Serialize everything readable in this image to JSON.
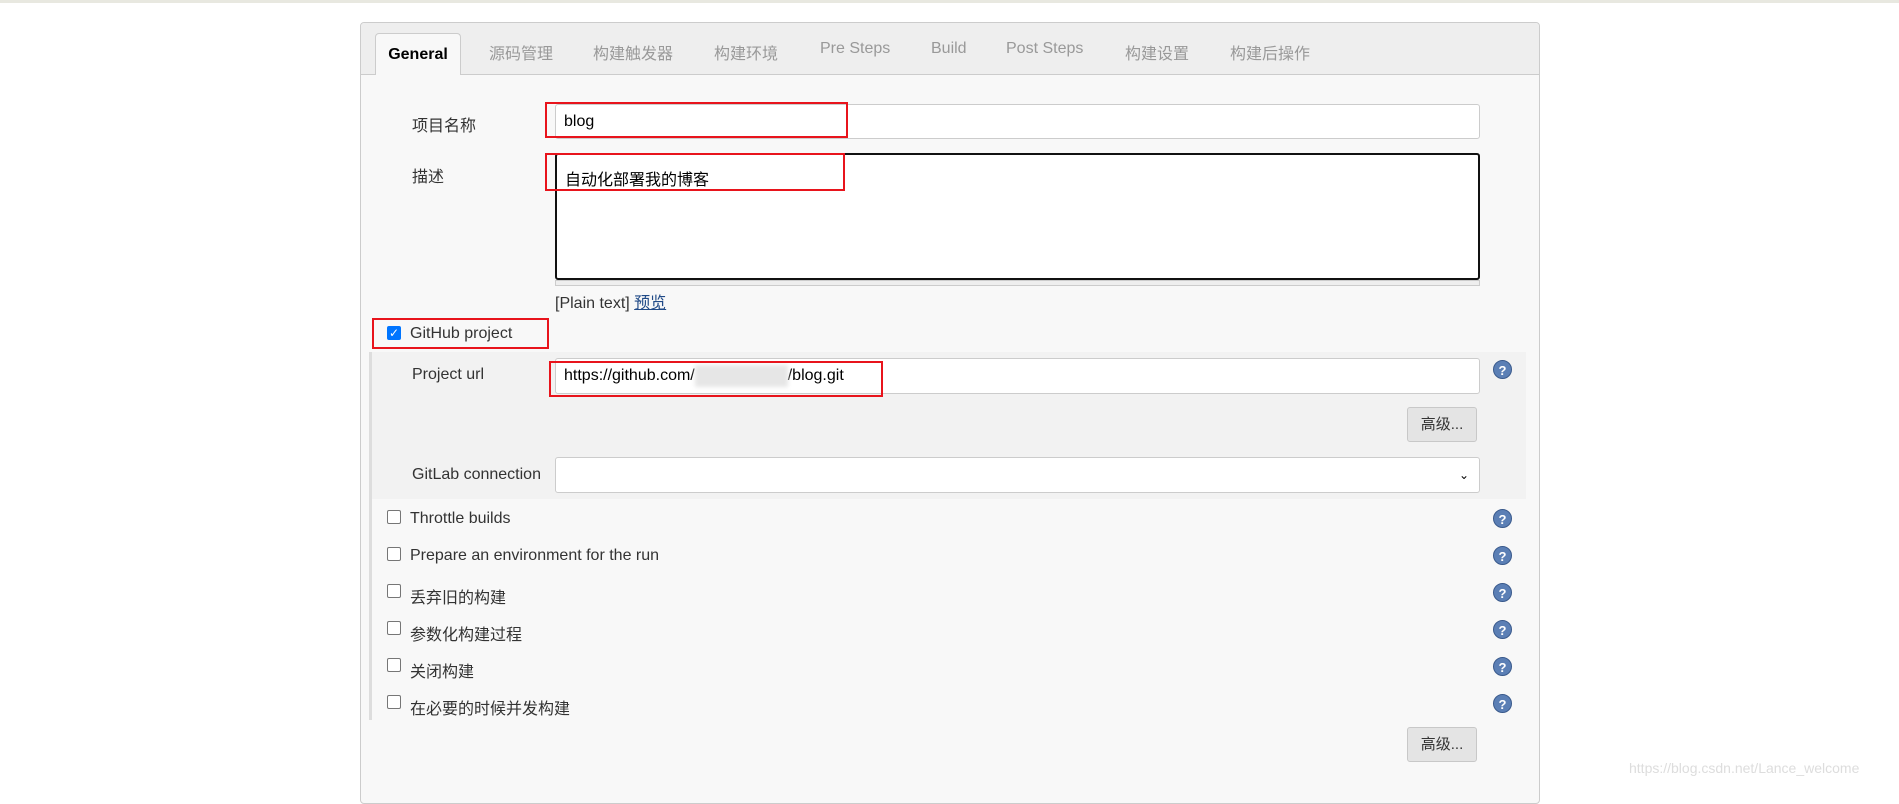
{
  "tabs": [
    {
      "label": "General",
      "active": true
    },
    {
      "label": "源码管理"
    },
    {
      "label": "构建触发器"
    },
    {
      "label": "构建环境"
    },
    {
      "label": "Pre Steps"
    },
    {
      "label": "Build"
    },
    {
      "label": "Post Steps"
    },
    {
      "label": "构建设置"
    },
    {
      "label": "构建后操作"
    }
  ],
  "form": {
    "name_label": "项目名称",
    "name_value": "blog",
    "desc_label": "描述",
    "desc_value": "自动化部署我的博客",
    "plain_text": "[Plain text]",
    "preview_link": "预览",
    "github_project_label": "GitHub project",
    "github_project_checked": true,
    "project_url_label": "Project url",
    "project_url_prefix": "https://github.com/",
    "project_url_suffix": "/blog.git",
    "advanced_label": "高级...",
    "gitlab_label": "GitLab connection",
    "gitlab_value": "",
    "options": [
      {
        "label": "Throttle builds",
        "checked": false
      },
      {
        "label": "Prepare an environment for the run",
        "checked": false
      },
      {
        "label": "丢弃旧的构建",
        "checked": false
      },
      {
        "label": "参数化构建过程",
        "checked": false
      },
      {
        "label": "关闭构建",
        "checked": false
      },
      {
        "label": "在必要的时候并发构建",
        "checked": false
      }
    ],
    "advanced_bottom_label": "高级..."
  },
  "watermark": "https://blog.csdn.net/Lance_welcome",
  "colors": {
    "highlight": "#e8141c",
    "help": "#5b7fb5",
    "checkbox": "#0075ff"
  }
}
